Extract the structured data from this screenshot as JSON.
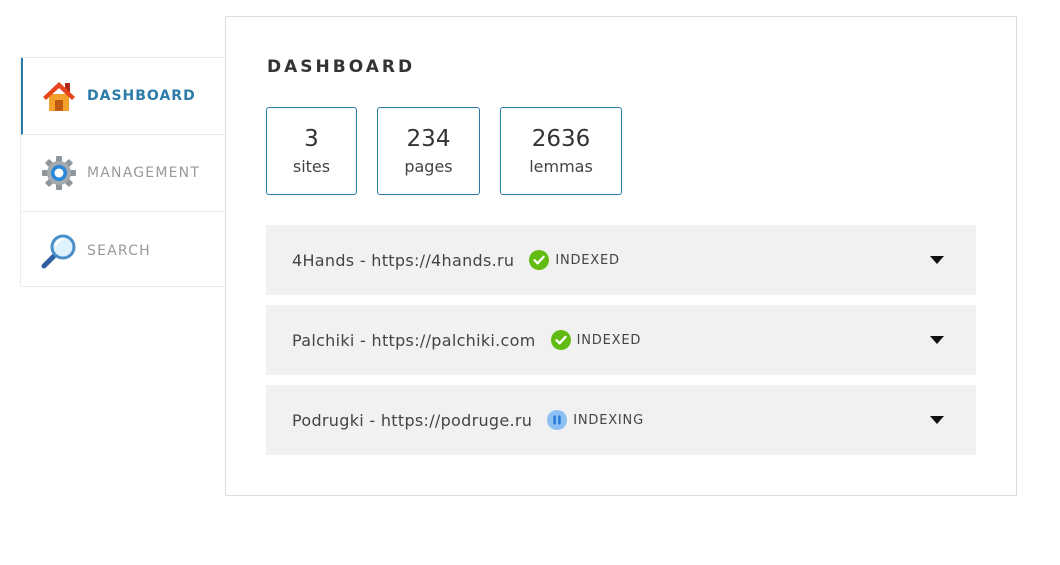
{
  "sidebar": {
    "items": [
      {
        "label": "DASHBOARD",
        "icon": "home-icon",
        "active": true
      },
      {
        "label": "MANAGEMENT",
        "icon": "gear-icon",
        "active": false
      },
      {
        "label": "SEARCH",
        "icon": "magnifier-icon",
        "active": false
      }
    ]
  },
  "main": {
    "title": "DASHBOARD",
    "stats": [
      {
        "value": "3",
        "label": "sites"
      },
      {
        "value": "234",
        "label": "pages"
      },
      {
        "value": "2636",
        "label": "lemmas"
      }
    ],
    "sites": [
      {
        "name": "4Hands - https://4hands.ru",
        "status": "INDEXED",
        "status_icon": "check-circle-icon"
      },
      {
        "name": "Palchiki - https://palchiki.com",
        "status": "INDEXED",
        "status_icon": "check-circle-icon"
      },
      {
        "name": "Podrugki - https://podruge.ru",
        "status": "INDEXING",
        "status_icon": "pause-circle-icon"
      }
    ]
  },
  "colors": {
    "accent": "#2b7aa8",
    "indexed": "#62bb12",
    "indexing": "#8cc0f2",
    "row_background": "#f1f1f1"
  }
}
